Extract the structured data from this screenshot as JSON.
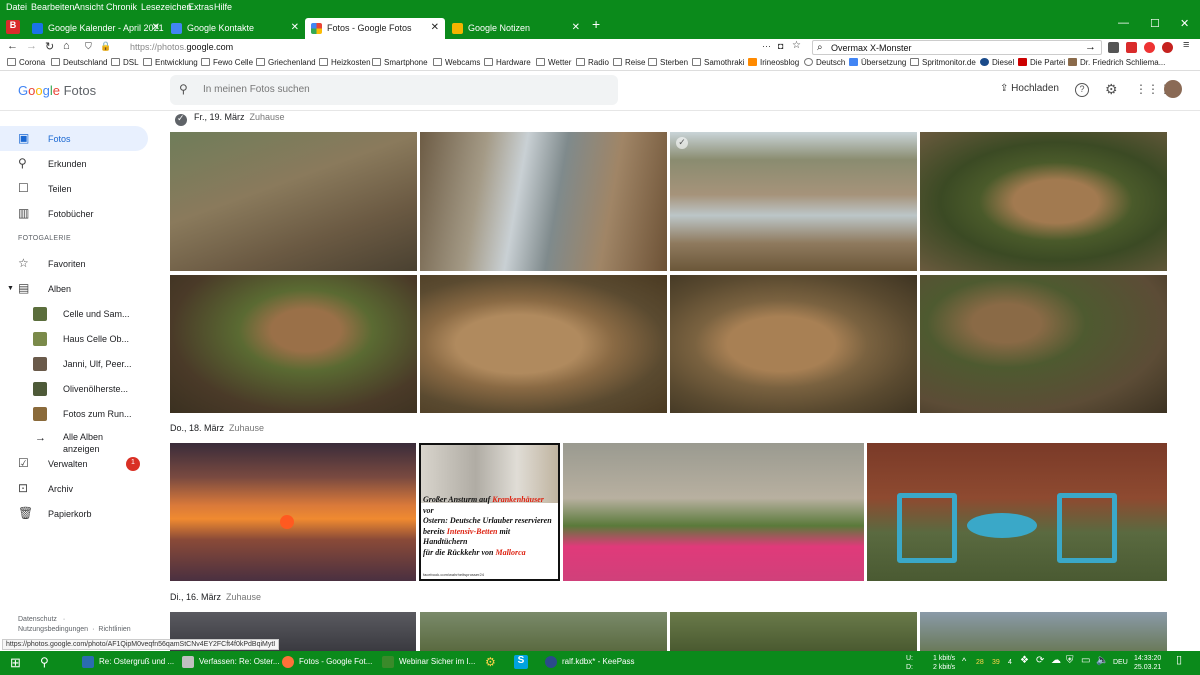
{
  "browser_menu": [
    "Datei",
    "Bearbeiten",
    "Ansicht",
    "Chronik",
    "Lesezeichen",
    "Extras",
    "Hilfe"
  ],
  "tabs": [
    {
      "title": "Google Kalender - April 2021",
      "icon_color": "#1a73e8",
      "active": false
    },
    {
      "title": "Google Kontakte",
      "icon_color": "#4285f4",
      "active": false
    },
    {
      "title": "Fotos - Google Fotos",
      "icon_color": "#fbbc04",
      "active": true
    },
    {
      "title": "Google Notizen",
      "icon_color": "#f4b400",
      "active": false
    }
  ],
  "url": {
    "prefix": "https://photos.",
    "host": "google.com"
  },
  "url_search": "Overmax X-Monster",
  "bookmarks": [
    "Corona",
    "Deutschland",
    "DSL",
    "Entwicklung",
    "Fewo Celle",
    "Griechenland",
    "Heizkosten",
    "Smartphone",
    "Webcams",
    "Hardware",
    "Wetter",
    "Radio",
    "Reise",
    "Sterben",
    "Samothraki",
    "Irineosblog",
    "Deutsch",
    "Übersetzung",
    "Spritmonitor.de",
    "Diesel",
    "Die Partei",
    "Dr. Friedrich Schliema..."
  ],
  "app": {
    "logo_google": "Google",
    "logo_fotos": "Fotos",
    "search_placeholder": "In meinen Fotos suchen",
    "upload_label": "Hochladen"
  },
  "sidebar": {
    "items_top": [
      {
        "label": "Fotos",
        "icon": "photo-icon"
      },
      {
        "label": "Erkunden",
        "icon": "search-icon"
      },
      {
        "label": "Teilen",
        "icon": "share-icon"
      },
      {
        "label": "Fotobücher",
        "icon": "book-icon"
      }
    ],
    "section_label": "FOTOGALERIE",
    "favorites": "Favoriten",
    "albums": "Alben",
    "album_list": [
      {
        "label": "Celle und Sam...",
        "color": "#5b6e3c"
      },
      {
        "label": "Haus Celle Ob...",
        "color": "#7a8a4a"
      },
      {
        "label": "Janni, Ulf, Peer...",
        "color": "#6a5a4a"
      },
      {
        "label": "Olivenölherste...",
        "color": "#4e5a38"
      },
      {
        "label": "Fotos zum Run...",
        "color": "#8a6a3a"
      }
    ],
    "all_albums_line1": "Alle Alben",
    "all_albums_line2": "anzeigen",
    "manage": "Verwalten",
    "manage_badge": "1",
    "archive": "Archiv",
    "trash": "Papierkorb",
    "footer": {
      "privacy": "Datenschutz",
      "terms": "Nutzungsbedingungen",
      "guidelines": "Richtlinien"
    }
  },
  "days": [
    {
      "date": "Fr., 19. März",
      "location": "Zuhause"
    },
    {
      "date": "Do., 18. März",
      "location": "Zuhause"
    },
    {
      "date": "Di., 16. März",
      "location": "Zuhause"
    }
  ],
  "meme": {
    "line1a": "Großer Ansturm auf ",
    "line1b": "Krankenhäuser",
    "line1c": " vor",
    "line2": "Ostern: Deutsche Urlauber reservieren",
    "line3a": "bereits ",
    "line3b": "Intensiv-Betten",
    "line3c": " mit Handtüchern",
    "line4a": "für die Rückkehr von ",
    "line4b": "Mallorca",
    "source": "facebook.com/wahrheitsprosser24"
  },
  "status_url": "https://photos.google.com/photo/AF1QipM0veqfn56qamStCNv4EY2FCft4f0kPdBqiMytI",
  "taskbar": [
    {
      "label": "Re: Ostergruß und ...",
      "color": "#2b6cb0"
    },
    {
      "label": "Verfassen: Re: Oster...",
      "color": "#c0c0c0"
    },
    {
      "label": "Fotos - Google Fot...",
      "color": "#ff7139"
    },
    {
      "label": "Webinar Sicher im I...",
      "color": "#3a8a2a"
    },
    {
      "label": "ralf.kdbx* - KeePass",
      "color": "#2b4a8a"
    }
  ],
  "tray": {
    "net_u": "U:",
    "net_d": "D:",
    "up": "1 kbit/s",
    "down": "2 kbit/s",
    "n1": "28",
    "n2": "39",
    "n3": "4",
    "lang": "DEU",
    "time": "14:33:20",
    "date": "25.03.21"
  }
}
